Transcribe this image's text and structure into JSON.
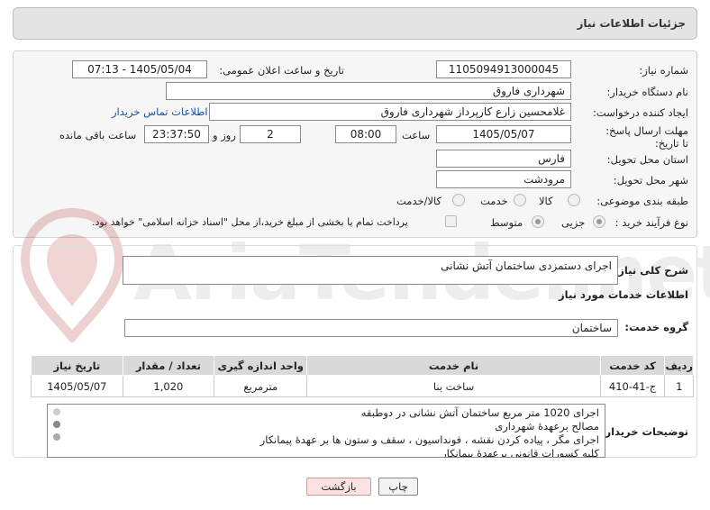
{
  "header": {
    "title": "جزئیات اطلاعات نیاز"
  },
  "form": {
    "need_number_label": "شماره نیاز:",
    "need_number": "1105094913000045",
    "announce_datetime_label": "تاریخ و ساعت اعلان عمومی:",
    "announce_datetime": "1405/05/04 - 07:13",
    "buyer_org_label": "نام دستگاه خریدار:",
    "buyer_org": "شهرداری فاروق",
    "creator_label": "ایجاد کننده درخواست:",
    "creator": "غلامحسین زارع کارپرداز شهرداری فاروق",
    "contact_link": "اطلاعات تماس خریدار",
    "deadline_label": "مهلت ارسال پاسخ: تا تاریخ:",
    "deadline_date": "1405/05/07",
    "time_label": "ساعت",
    "deadline_time": "08:00",
    "days_value": "2",
    "days_label": "روز و",
    "remaining_time": "23:37:50",
    "remaining_label": "ساعت باقی مانده",
    "province_label": "استان محل تحویل:",
    "province": "فارس",
    "city_label": "شهر محل تحویل:",
    "city": "مرودشت",
    "category_label": "طبقه بندی موضوعی:",
    "category_options": [
      "کالا",
      "خدمت",
      "کالا/خدمت"
    ],
    "category_selected": "خدمت",
    "process_label": "نوع فرآیند خرید :",
    "process_options": [
      "جزیی",
      "متوسط"
    ],
    "process_selected": "جزیی",
    "payment_note": "پرداخت تمام یا بخشی از مبلغ خرید،از محل \"اسناد خزانه اسلامی\" خواهد بود."
  },
  "summary": {
    "label": "شرح کلی نیاز:",
    "value": "اجرای دستمزدی ساختمان آتش نشانی"
  },
  "services": {
    "section_title": "اطلاعات خدمات مورد نیاز",
    "group_label": "گروه خدمت:",
    "group_value": "ساختمان",
    "table_headers": [
      "ردیف",
      "کد خدمت",
      "نام خدمت",
      "واحد اندازه گیری",
      "تعداد / مقدار",
      "تاریخ نیاز"
    ],
    "rows": [
      [
        "1",
        "ج-41-410",
        "ساخت بنا",
        "مترمربع",
        "1,020",
        "1405/05/07"
      ]
    ]
  },
  "notes": {
    "label": "توضیحات خریدار:",
    "lines": [
      "اجرای 1020 متر مربع ساختمان آتش نشانی در دوطبقه",
      "مصالح برعهدۀ شهرداری",
      "اجرای مگر ، پیاده کردن نقشه ، فونداسیون ، سقف و ستون ها بر عهدۀ پیمانکار",
      "کلیه کسورات قانونی برعهدۀ پیمانکار"
    ]
  },
  "buttons": {
    "print": "چاپ",
    "back": "بازگشت"
  },
  "watermark": {
    "text": "AriaTender.net"
  },
  "colors": {
    "link": "#1a4fa8",
    "header_bg": "#e4e4e4",
    "back_button_bg": "#fbe3e3"
  }
}
